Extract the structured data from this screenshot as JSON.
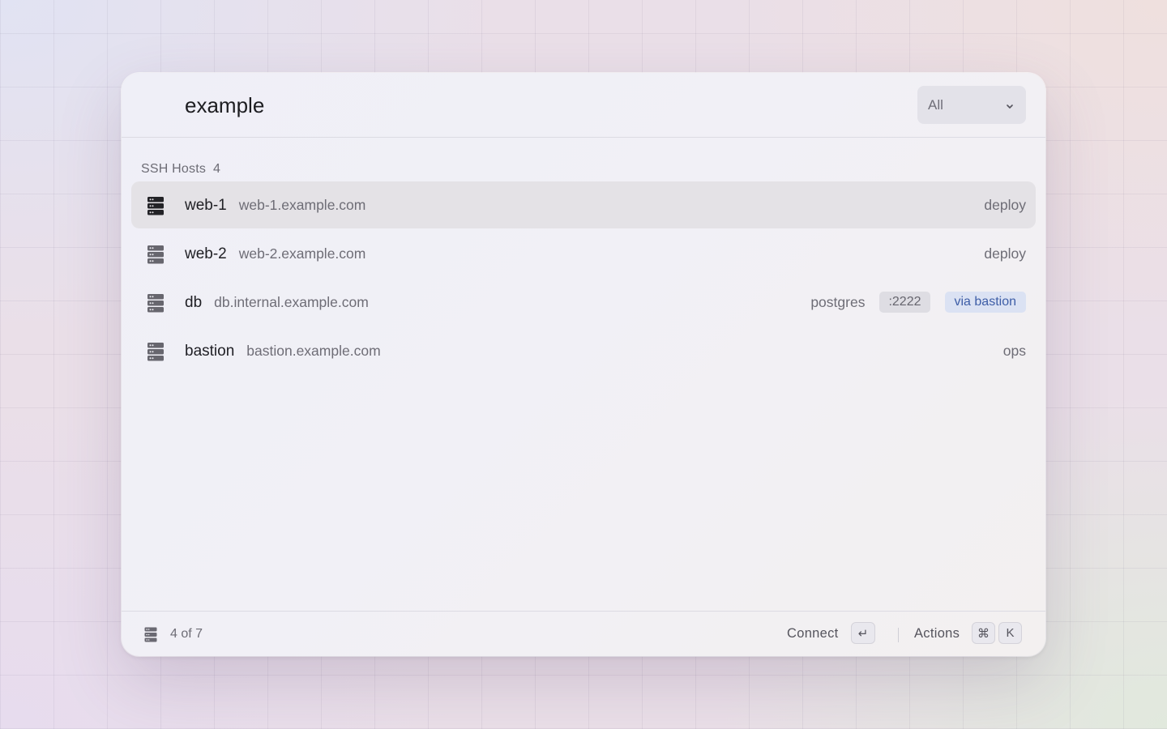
{
  "search": {
    "value": "example",
    "placeholder": ""
  },
  "filter": {
    "selected": "All"
  },
  "section": {
    "title": "SSH Hosts",
    "count": "4"
  },
  "hosts": [
    {
      "name": "web-1",
      "host": "web-1.example.com",
      "user": "deploy",
      "icon": "server-icon",
      "selected": true
    },
    {
      "name": "web-2",
      "host": "web-2.example.com",
      "user": "deploy",
      "icon": "server-icon"
    },
    {
      "name": "db",
      "host": "db.internal.example.com",
      "user": "postgres",
      "port": ":2222",
      "via": "via bastion",
      "icon": "server-icon"
    },
    {
      "name": "bastion",
      "host": "bastion.example.com",
      "user": "ops",
      "icon": "server-icon"
    }
  ],
  "footer": {
    "count_label": "4 of 7",
    "connect_label": "Connect",
    "connect_key": "↵",
    "actions_label": "Actions",
    "actions_key_1": "⌘",
    "actions_key_2": "K"
  },
  "colors": {
    "selected_row": "#e4e2e6",
    "via_badge_bg": "#dbe2f3",
    "via_badge_text": "#3e5ea7",
    "port_badge_bg": "#dedde3"
  }
}
